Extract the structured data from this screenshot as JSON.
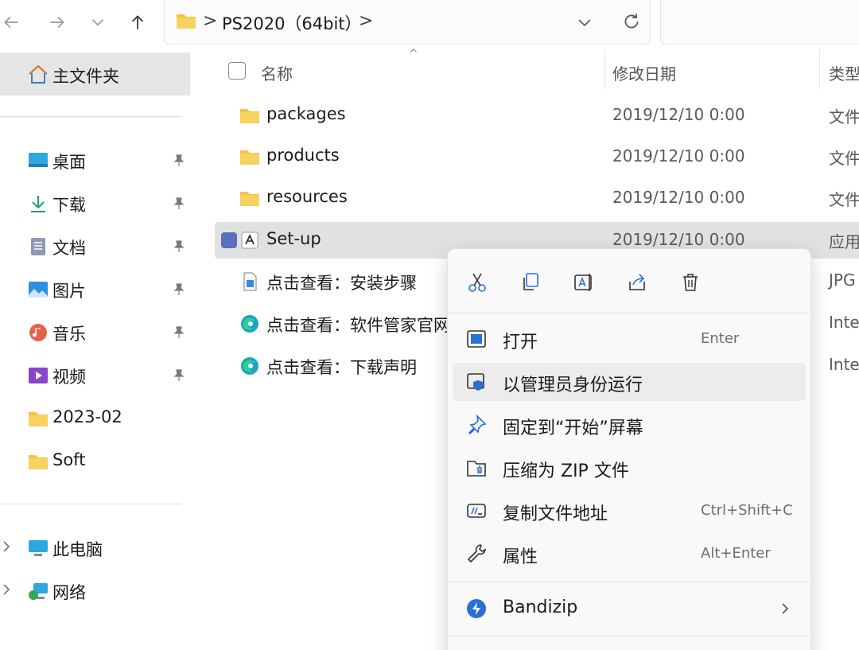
{
  "toolbar": {
    "breadcrumb_sep": ">",
    "path_segment": "PS2020（64bit）",
    "trailing_sep": ">"
  },
  "sidebar": {
    "home": "主文件夹",
    "quick_access": [
      {
        "label": "桌面",
        "icon": "desktop-icon",
        "pinned": true
      },
      {
        "label": "下载",
        "icon": "download-icon",
        "pinned": true
      },
      {
        "label": "文档",
        "icon": "documents-icon",
        "pinned": true
      },
      {
        "label": "图片",
        "icon": "pictures-icon",
        "pinned": true
      },
      {
        "label": "音乐",
        "icon": "music-icon",
        "pinned": true
      },
      {
        "label": "视频",
        "icon": "videos-icon",
        "pinned": true
      },
      {
        "label": "2023-02",
        "icon": "folder-icon",
        "pinned": false
      },
      {
        "label": "Soft",
        "icon": "folder-icon",
        "pinned": false
      }
    ],
    "this_pc": "此电脑",
    "network": "网络"
  },
  "columns": {
    "name": "名称",
    "date": "修改日期",
    "type": "类型"
  },
  "files": [
    {
      "name": "packages",
      "date": "2019/12/10 0:00",
      "type": "文件",
      "icon": "folder-icon"
    },
    {
      "name": "products",
      "date": "2019/12/10 0:00",
      "type": "文件",
      "icon": "folder-icon"
    },
    {
      "name": "resources",
      "date": "2019/12/10 0:00",
      "type": "文件",
      "icon": "folder-icon"
    },
    {
      "name": "Set-up",
      "date": "2019/12/10 0:00",
      "type": "应用",
      "icon": "adobe-setup-icon",
      "selected": true
    },
    {
      "name": "点击查看：安装步骤",
      "date": "",
      "type": "JPG",
      "icon": "image-file-icon"
    },
    {
      "name": "点击查看：软件管家官网",
      "date": "",
      "type": "Inte",
      "icon": "edge-icon"
    },
    {
      "name": "点击查看：下载声明",
      "date": "",
      "type": "Inte",
      "icon": "edge-icon"
    }
  ],
  "context_menu": {
    "quick_actions": [
      "cut-icon",
      "copy-icon",
      "rename-icon",
      "share-icon",
      "delete-icon"
    ],
    "items": [
      {
        "label": "打开",
        "shortcut": "Enter",
        "icon": "open-icon"
      },
      {
        "label": "以管理员身份运行",
        "shortcut": "",
        "icon": "run-as-admin-icon",
        "hover": true
      },
      {
        "label": "固定到“开始”屏幕",
        "shortcut": "",
        "icon": "pin-icon"
      },
      {
        "label": "压缩为 ZIP 文件",
        "shortcut": "",
        "icon": "zip-icon"
      },
      {
        "label": "复制文件地址",
        "shortcut": "Ctrl+Shift+C",
        "icon": "copy-path-icon"
      },
      {
        "label": "属性",
        "shortcut": "Alt+Enter",
        "icon": "wrench-icon"
      },
      {
        "label": "Bandizip",
        "shortcut": "",
        "icon": "bandizip-icon",
        "submenu": true
      }
    ]
  },
  "colors": {
    "folder": "#f3c343",
    "selection": "#e1e1e1",
    "accent": "#2a6fd6"
  }
}
